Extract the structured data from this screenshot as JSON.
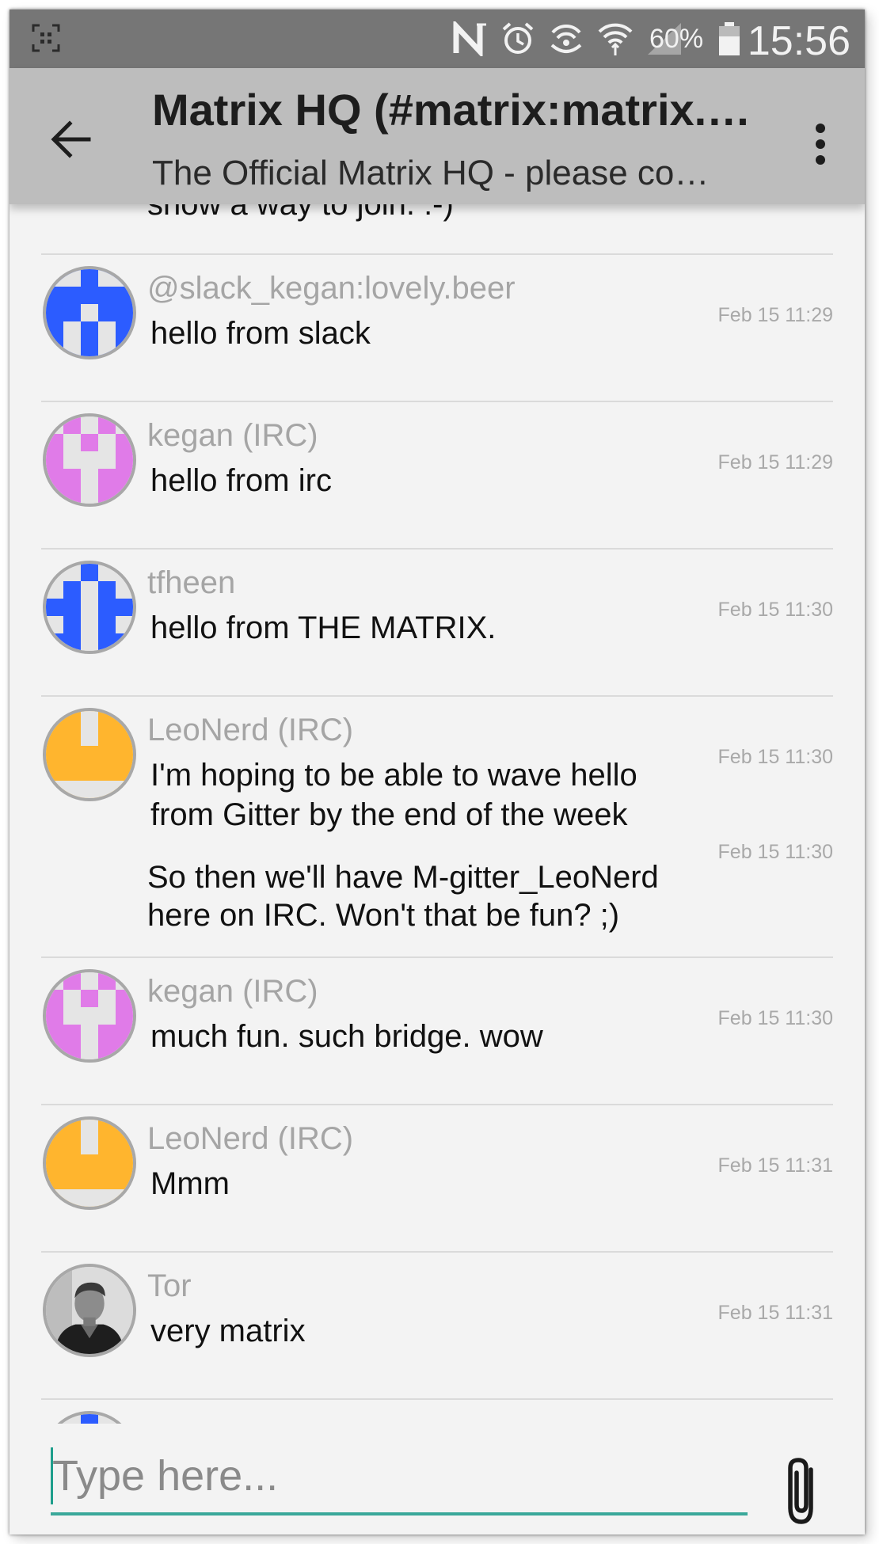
{
  "status_bar": {
    "battery_percent": "60%",
    "time": "15:56",
    "icons": [
      "screenshot-icon",
      "nfc-icon",
      "alarm-icon",
      "hotspot-icon",
      "wifi-icon",
      "signal-icon",
      "battery-icon"
    ]
  },
  "toolbar": {
    "title": "Matrix HQ (#matrix:matrix.…",
    "topic": "The Official Matrix HQ - please co…",
    "back_icon": "arrow-back-icon",
    "menu_icon": "more-vert-icon"
  },
  "timeline": {
    "partial_previous_text": "show a way to join. :-)",
    "messages": [
      {
        "sender": "@slack_kegan:lovely.beer",
        "body": "hello from slack",
        "timestamp": "Feb 15 11:29",
        "avatar": "identicon-blue"
      },
      {
        "sender": "kegan (IRC)",
        "body": "hello from irc",
        "timestamp": "Feb 15 11:29",
        "avatar": "identicon-pink"
      },
      {
        "sender": "tfheen",
        "body": "hello from THE MATRIX.",
        "timestamp": "Feb 15 11:30",
        "avatar": "identicon-blue-cross"
      },
      {
        "sender": "LeoNerd (IRC)",
        "body": "I'm hoping to be able to wave hello from Gitter by the end of the week",
        "timestamp": "Feb 15 11:30",
        "avatar": "identicon-orange",
        "followup": {
          "body": "So then we'll have  M-gitter_LeoNerd here on IRC. Won't that be fun? ;)",
          "timestamp": "Feb 15 11:30"
        }
      },
      {
        "sender": "kegan (IRC)",
        "body": "much fun. such bridge. wow",
        "timestamp": "Feb 15 11:30",
        "avatar": "identicon-pink"
      },
      {
        "sender": "LeoNerd (IRC)",
        "body": "Mmm",
        "timestamp": "Feb 15 11:31",
        "avatar": "identicon-orange"
      },
      {
        "sender": "Tor",
        "body": "very matrix",
        "timestamp": "Feb 15 11:31",
        "avatar": "photo"
      }
    ]
  },
  "composer": {
    "placeholder": "Type here...",
    "attach_icon": "paperclip-icon"
  },
  "colors": {
    "status_bar": "#767676",
    "toolbar": "#bdbdbd",
    "accent": "#3aa89a",
    "identicon_blue": "#2c5cff",
    "identicon_pink": "#e07be8",
    "identicon_orange": "#ffb52e"
  }
}
